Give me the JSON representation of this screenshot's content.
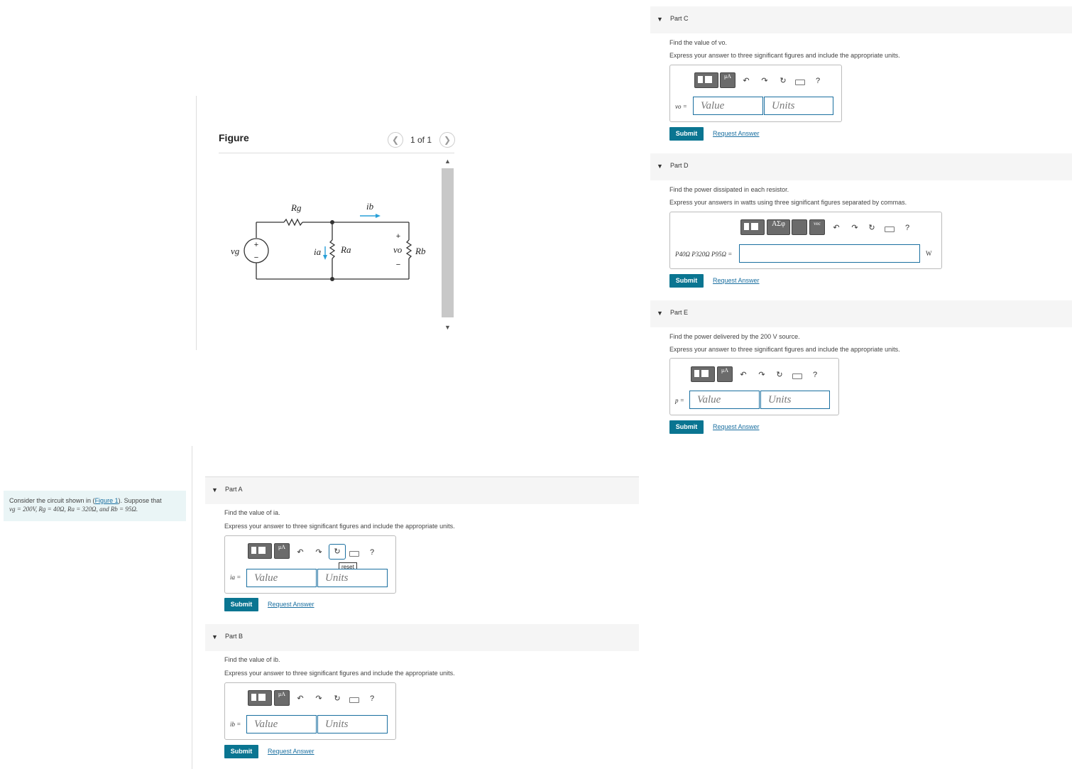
{
  "problem": {
    "intro_pre": "Consider the circuit shown in (",
    "figure_link": "Figure 1",
    "intro_mid": "). Suppose that",
    "givens": "vg = 200V, Rg = 40Ω, Ra = 320Ω, and Rb = 95Ω."
  },
  "figure": {
    "title": "Figure",
    "pager": "1 of 1",
    "labels": {
      "Rg": "Rg",
      "ib": "ib",
      "vg": "vg",
      "ia": "ia",
      "Ra": "Ra",
      "vo": "vo",
      "Rb": "Rb",
      "plus": "+",
      "minus": "−"
    }
  },
  "common": {
    "express_units": "Express your answer to three significant figures and include the appropriate units.",
    "value_placeholder": "Value",
    "units_placeholder": "Units",
    "submit": "Submit",
    "request": "Request Answer",
    "reset_tip": "reset",
    "help": "?"
  },
  "parts": {
    "A": {
      "label": "Part A",
      "question": "Find the value of ia.",
      "var": "ia ="
    },
    "B": {
      "label": "Part B",
      "question": "Find the value of ib.",
      "var": "ib ="
    },
    "C": {
      "label": "Part C",
      "question": "Find the value of vo.",
      "var": "vo ="
    },
    "D": {
      "label": "Part D",
      "question": "Find the power dissipated in each resistor.",
      "express": "Express your answers in watts using three significant figures separated by commas.",
      "var": "P40Ω P320Ω P95Ω =",
      "unit": "W",
      "sym_btn": "ΑΣφ",
      "vec_btn": "vec"
    },
    "E": {
      "label": "Part E",
      "question": "Find the power delivered by the 200 V source.",
      "var": "p ="
    }
  }
}
